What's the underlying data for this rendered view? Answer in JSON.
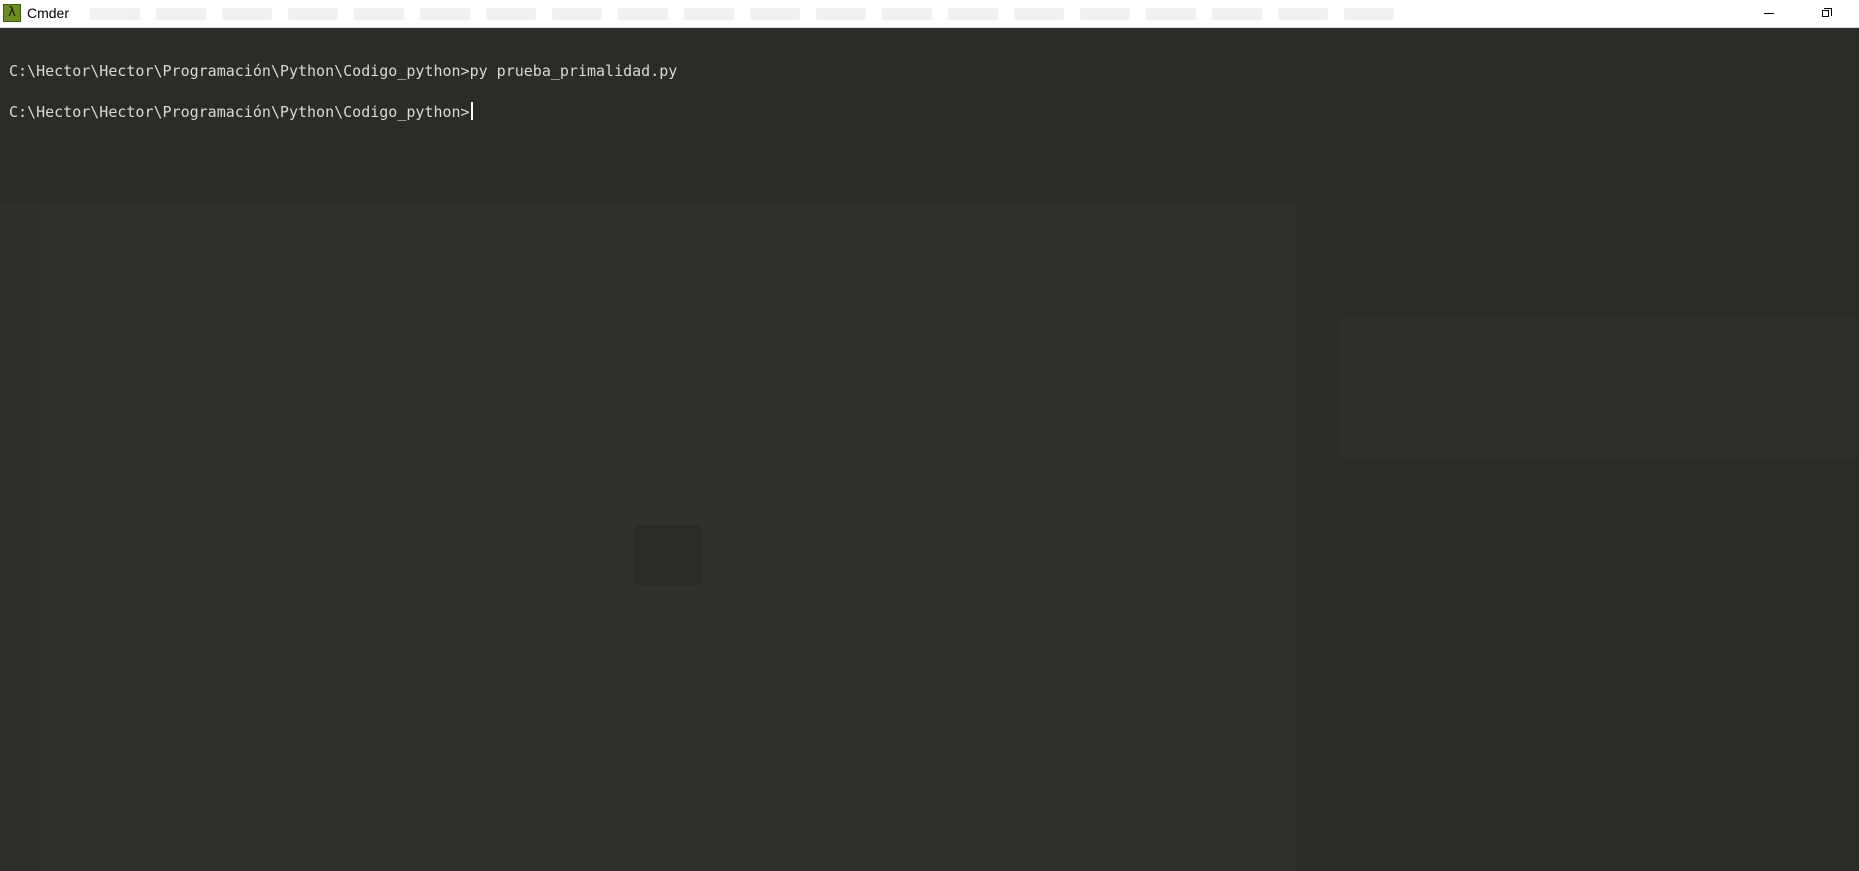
{
  "window": {
    "title": "Cmder",
    "app_icon": "lambda-icon",
    "app_icon_glyph": "λ",
    "controls": [
      "minimize-icon",
      "restore-icon"
    ]
  },
  "terminal": {
    "lines": [
      {
        "prompt": "C:\\Hector\\Hector\\Programación\\Python\\Codigo_python>",
        "command": "py prueba_primalidad.py"
      },
      {
        "prompt": "C:\\Hector\\Hector\\Programación\\Python\\Codigo_python>",
        "command": ""
      }
    ],
    "background_color": "#2b2c28",
    "text_color": "#d9d9d4",
    "cursor_color": "#ffffff"
  }
}
